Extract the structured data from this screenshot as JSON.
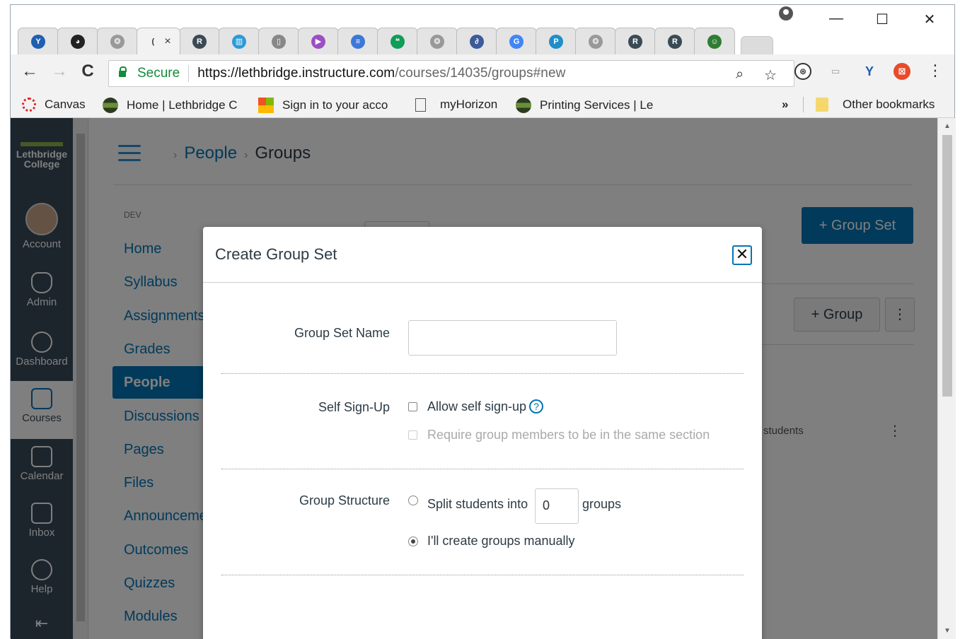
{
  "browser": {
    "tabs": [
      {
        "icon": "y-icon",
        "color": "#1f5fb0",
        "glyph": "Y"
      },
      {
        "icon": "dark-circle-icon",
        "color": "#222",
        "glyph": "◕"
      },
      {
        "icon": "canvas-icon",
        "color": "#999",
        "glyph": "❂"
      },
      {
        "icon": "loading-icon",
        "color": "#999",
        "glyph": "(",
        "active": true
      },
      {
        "icon": "r-icon",
        "color": "#3a4a55",
        "glyph": "R"
      },
      {
        "icon": "chart-icon",
        "color": "#2c9bd6",
        "glyph": "▥"
      },
      {
        "icon": "page-icon",
        "color": "#888",
        "glyph": "▯"
      },
      {
        "icon": "slides-icon",
        "color": "#9c4fc2",
        "glyph": "▶"
      },
      {
        "icon": "docs-icon",
        "color": "#3d78d8",
        "glyph": "≡"
      },
      {
        "icon": "hangouts-icon",
        "color": "#0f9d58",
        "glyph": "❝"
      },
      {
        "icon": "canvas-icon",
        "color": "#999",
        "glyph": "❂"
      },
      {
        "icon": "feather-icon",
        "color": "#3d5a9a",
        "glyph": "∂"
      },
      {
        "icon": "google-icon",
        "color": "#4285f4",
        "glyph": "G"
      },
      {
        "icon": "pinterest-icon",
        "color": "#1f8ec9",
        "glyph": "P"
      },
      {
        "icon": "canvas-icon",
        "color": "#999",
        "glyph": "❂"
      },
      {
        "icon": "r-icon",
        "color": "#3a4a55",
        "glyph": "R"
      },
      {
        "icon": "r-icon",
        "color": "#3a4a55",
        "glyph": "R"
      },
      {
        "icon": "cartoon-icon",
        "color": "#2e7d32",
        "glyph": "☺"
      }
    ],
    "active_tab_close": "×",
    "minimize": "—",
    "maximize": "☐",
    "close": "✕",
    "back": "←",
    "forward": "→",
    "reload": "C",
    "secure_label": "Secure",
    "url_host": "https://lethbridge.instructure.com",
    "url_path": "/courses/14035/groups#new",
    "zoom_icon": "⌕",
    "star_icon": "☆",
    "menu_icon": "⋮",
    "bookmarks": [
      {
        "label": "Canvas",
        "color": "#e0262b"
      },
      {
        "label": "Home | Lethbridge C",
        "color": "#2d3b1f"
      },
      {
        "label": "Sign in to your acco",
        "color": "#f25022"
      },
      {
        "label": "myHorizon",
        "color": "#ffffff"
      },
      {
        "label": "Printing Services | Le",
        "color": "#2d3b1f"
      }
    ],
    "more_bookmarks": "»",
    "other_bookmarks": "Other bookmarks"
  },
  "global_nav": {
    "logo_line1": "Lethbridge",
    "logo_line2": "College",
    "items": [
      {
        "label": "Account"
      },
      {
        "label": "Admin"
      },
      {
        "label": "Dashboard"
      },
      {
        "label": "Courses",
        "active": true
      },
      {
        "label": "Calendar"
      },
      {
        "label": "Inbox"
      },
      {
        "label": "Help"
      }
    ]
  },
  "breadcrumb": {
    "people": "People",
    "groups": "Groups"
  },
  "course_nav": {
    "section_label": "DEV",
    "items": [
      "Home",
      "Syllabus",
      "Assignments",
      "Grades",
      "People",
      "Discussions",
      "Pages",
      "Files",
      "Announcements",
      "Outcomes",
      "Quizzes",
      "Modules"
    ],
    "active_index": 4
  },
  "background_buttons": {
    "group_set": "+ Group Set",
    "group": "+ Group",
    "kebab": "⋮",
    "students_text": "students"
  },
  "modal": {
    "title": "Create Group Set",
    "close_glyph": "✕",
    "group_set_name_label": "Group Set Name",
    "group_set_name_value": "",
    "self_signup_label": "Self Sign-Up",
    "allow_self_signup": "Allow self sign-up",
    "help_glyph": "?",
    "require_same_section": "Require group members to be in the same section",
    "group_structure_label": "Group Structure",
    "split_students_into": "Split students into",
    "split_count": "0",
    "groups_suffix": "groups",
    "create_manually": "I'll create groups manually"
  }
}
